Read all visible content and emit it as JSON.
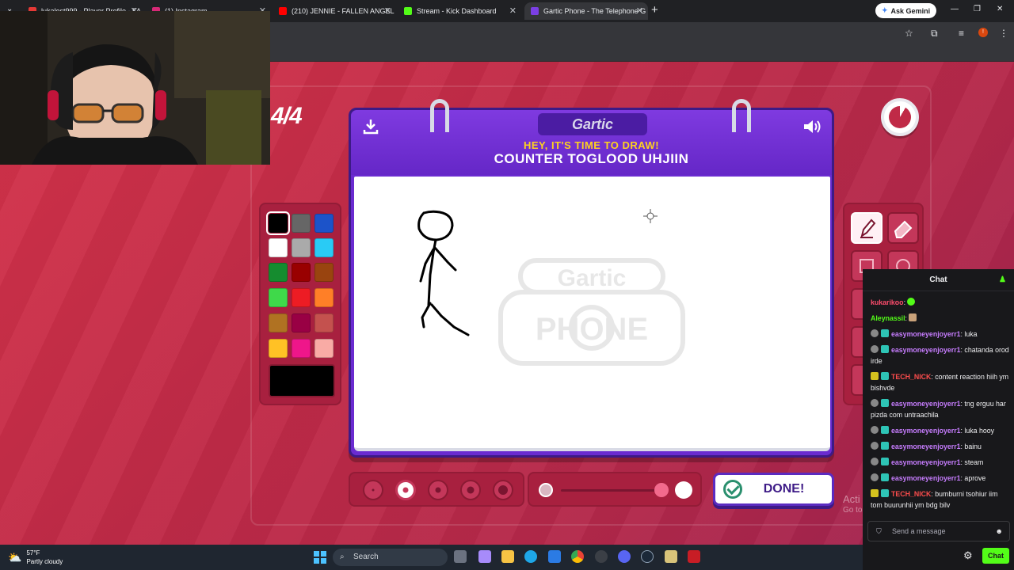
{
  "browser": {
    "tabs": [
      {
        "title": "lukalost999 - Player Profile - FA",
        "color": "#e53935"
      },
      {
        "title": "(1) Instagram",
        "color": "#d62976"
      },
      {
        "title": "(210) JENNIE - FALLEN ANGEL (",
        "color": "#ff0000"
      },
      {
        "title": "Stream - Kick Dashboard",
        "color": "#53fc18"
      },
      {
        "title": "Gartic Phone - The Telephone G",
        "color": "#7b3fe4"
      }
    ],
    "gemini_label": "Ask Gemini"
  },
  "game": {
    "round": "4/4",
    "logo": "Gartic",
    "prompt_hint": "HEY, IT'S TIME TO DRAW!",
    "prompt_word": "COUNTER TOGLOOD UHJIIN",
    "done_label": "DONE!",
    "watermark_top": "Gartic",
    "watermark_bottom": "PHONE",
    "colors": [
      "#000000",
      "#666666",
      "#1c53c9",
      "#ffffff",
      "#aaaaaa",
      "#29cbf5",
      "#158c2f",
      "#990000",
      "#99440f",
      "#3fd94a",
      "#ed1c24",
      "#ff7f27",
      "#b07222",
      "#990044",
      "#c4514e",
      "#ffc125",
      "#ef168a",
      "#f9aba5"
    ],
    "selected_color": "#000000",
    "brush_sizes": [
      2,
      4,
      6,
      8,
      10
    ],
    "selected_size": 4,
    "opacity_percent": 100,
    "tools": [
      "pen-icon",
      "eraser-icon",
      "square-icon",
      "circle-icon"
    ],
    "selected_tool": "pen-icon"
  },
  "windows_notice": {
    "line1": "Acti",
    "line2": "Go to"
  },
  "chat": {
    "title": "Chat",
    "messages": [
      {
        "user": "kukarikoo",
        "user_color": "#ff4d6d",
        "text": ""
      },
      {
        "user": "Aleynassil",
        "user_color": "#53fc18",
        "text": ""
      },
      {
        "user": "easymoneyenjoyerr1",
        "user_color": "#c77dff",
        "text": "luka"
      },
      {
        "user": "easymoneyenjoyerr1",
        "user_color": "#c77dff",
        "text": "chatanda orod irde"
      },
      {
        "user": "TECH_NICK",
        "user_color": "#ff4d4d",
        "text": "content reaction hiih ym bishvde"
      },
      {
        "user": "easymoneyenjoyerr1",
        "user_color": "#c77dff",
        "text": "tng erguu har pizda com untraachila"
      },
      {
        "user": "easymoneyenjoyerr1",
        "user_color": "#c77dff",
        "text": "luka hooy"
      },
      {
        "user": "easymoneyenjoyerr1",
        "user_color": "#c77dff",
        "text": "bainu"
      },
      {
        "user": "easymoneyenjoyerr1",
        "user_color": "#c77dff",
        "text": "steam"
      },
      {
        "user": "easymoneyenjoyerr1",
        "user_color": "#c77dff",
        "text": "aprove"
      },
      {
        "user": "TECH_NICK",
        "user_color": "#ff4d4d",
        "text": "bumburni tsohiur iim tom buurunhii ym bdg bilv"
      }
    ],
    "input_placeholder": "Send a message",
    "send_label": "Chat"
  },
  "taskbar": {
    "weather_temp": "57°F",
    "weather_desc": "Partly cloudy",
    "search_label": "Search"
  }
}
